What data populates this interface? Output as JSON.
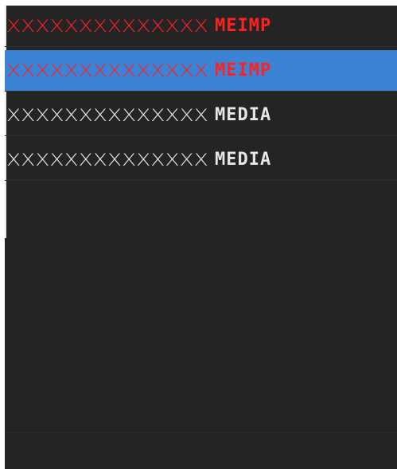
{
  "colors": {
    "background": "#242424",
    "selected": "#3a83d5",
    "red_text": "#ff2020",
    "white_text": "#e6e6e6"
  },
  "rows": [
    {
      "name": "XXXXXXXXXXXXXX",
      "tag": "MEIMP",
      "color": "red",
      "selected": false
    },
    {
      "name": "XXXXXXXXXXXXXX",
      "tag": "MEIMP",
      "color": "red",
      "selected": true
    },
    {
      "name": "XXXXXXXXXXXXXX",
      "tag": "MEDIA",
      "color": "white",
      "selected": false
    },
    {
      "name": "XXXXXXXXXXXXXX",
      "tag": "MEDIA",
      "color": "white",
      "selected": false
    }
  ]
}
